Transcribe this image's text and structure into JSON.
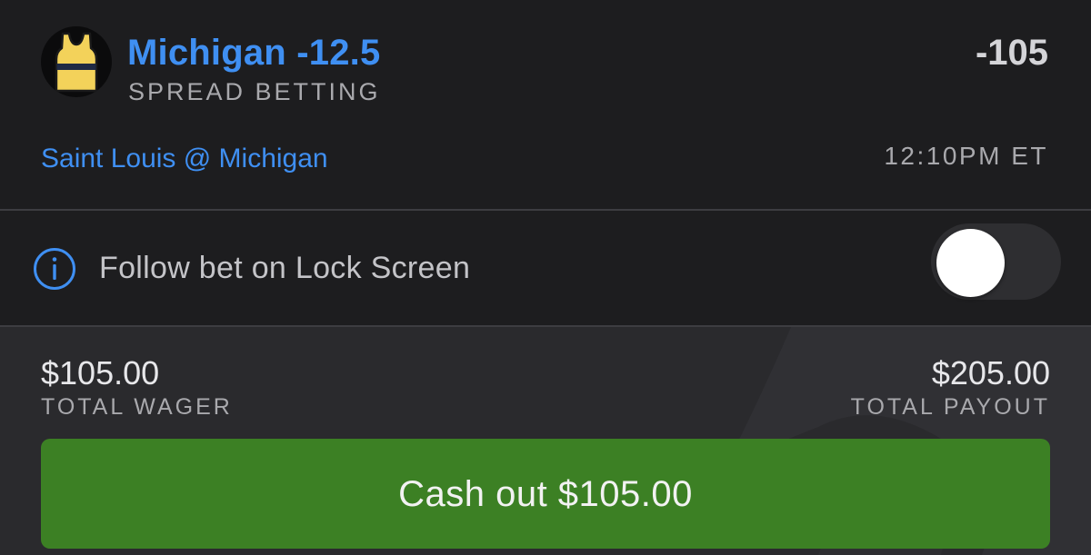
{
  "bet": {
    "team_logo_icon": "jersey-icon",
    "title": "Michigan -12.5",
    "type": "SPREAD BETTING",
    "odds": "-105",
    "matchup": "Saint Louis @ Michigan",
    "time": "12:10PM ET"
  },
  "lock_screen": {
    "info_icon": "info-icon",
    "label": "Follow bet on Lock Screen",
    "toggle_on": false
  },
  "summary": {
    "wager_amount": "$105.00",
    "wager_label": "TOTAL WAGER",
    "payout_amount": "$205.00",
    "payout_label": "TOTAL PAYOUT"
  },
  "cashout": {
    "label": "Cash out $105.00"
  },
  "colors": {
    "accent_blue": "#3f8ff2",
    "cashout_green": "#3c8024",
    "jersey_yellow": "#f3d25a",
    "jersey_stripe": "#1f2a44"
  }
}
